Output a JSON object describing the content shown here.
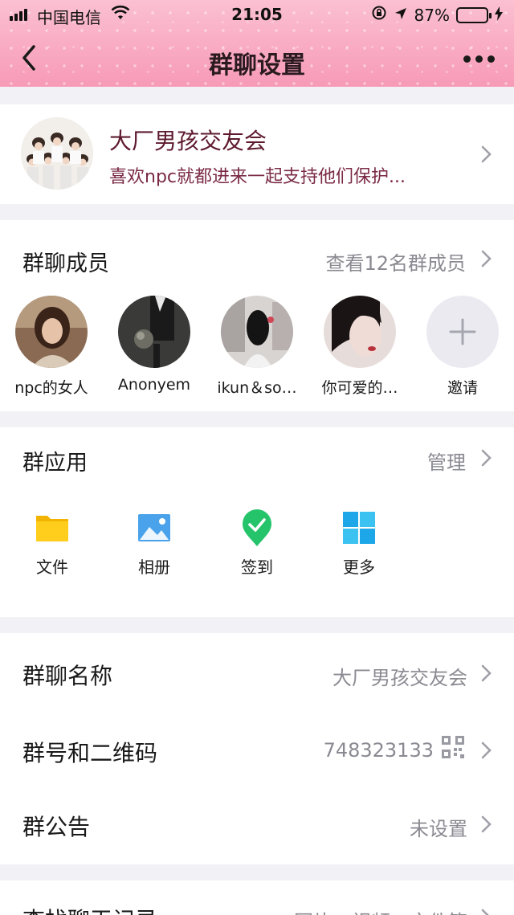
{
  "status_bar": {
    "carrier": "中国电信",
    "time": "21:05",
    "battery_text": "87%",
    "battery_level": 0.87
  },
  "nav": {
    "title": "群聊设置"
  },
  "group": {
    "name": "大厂男孩交友会",
    "description": "喜欢npc就都进来一起支持他们保护..."
  },
  "members": {
    "title": "群聊成员",
    "view_all": "查看12名群成员",
    "list": [
      {
        "name": "npc的女人",
        "color": "#6b4a38"
      },
      {
        "name": "Anonyem",
        "color": "#2b2b2b"
      },
      {
        "name": "ikun＆so…",
        "color": "#c7c2c3"
      },
      {
        "name": "你可爱的…",
        "color": "#d8c8c6"
      }
    ],
    "invite_label": "邀请"
  },
  "apps": {
    "title": "群应用",
    "manage": "管理",
    "items": [
      {
        "label": "文件",
        "icon": "folder-icon",
        "color": "#ffc61a"
      },
      {
        "label": "相册",
        "icon": "photo-icon",
        "color": "#4aa3ea"
      },
      {
        "label": "签到",
        "icon": "checkin-icon",
        "color": "#26c46a"
      },
      {
        "label": "更多",
        "icon": "grid-icon",
        "color": "#1ea7e8"
      }
    ]
  },
  "settings": {
    "rows": [
      {
        "title": "群聊名称",
        "value": "大厂男孩交友会"
      },
      {
        "title": "群号和二维码",
        "value": "748323133"
      },
      {
        "title": "群公告",
        "value": "未设置"
      }
    ]
  },
  "history": {
    "title": "查找聊天记录",
    "value": "图片、视频、文件等"
  }
}
